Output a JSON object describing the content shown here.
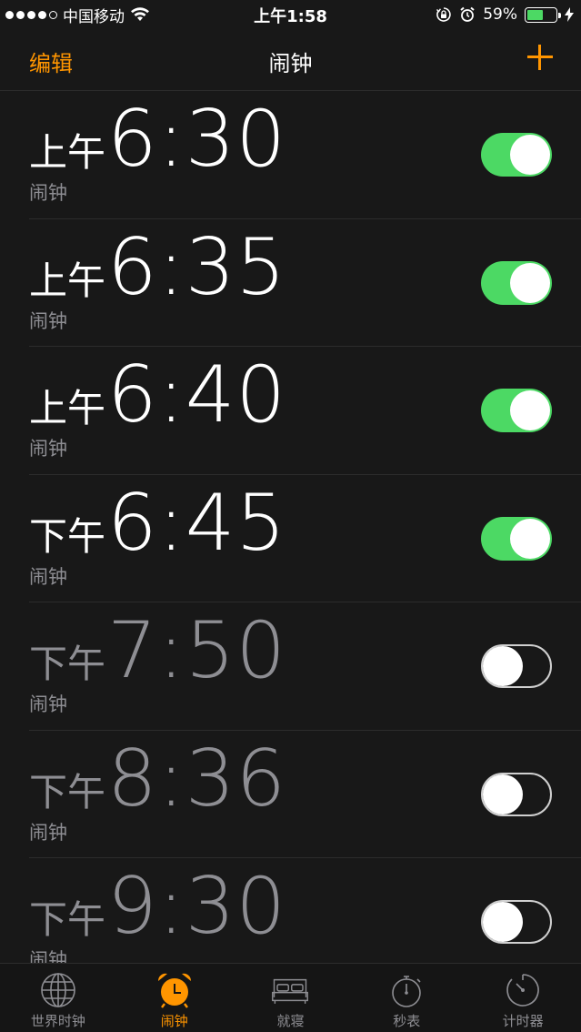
{
  "status_bar": {
    "carrier": "中国移动",
    "time": "上午1:58",
    "battery_percent": "59%",
    "battery_level": 0.59,
    "signal_bars": 4,
    "signal_total": 5
  },
  "nav": {
    "edit_label": "编辑",
    "title": "闹钟"
  },
  "colors": {
    "accent": "#ff9500",
    "toggle_on": "#4cd964",
    "background": "#181818"
  },
  "alarms": [
    {
      "ampm": "上午",
      "time": "6:30",
      "label": "闹钟",
      "enabled": true
    },
    {
      "ampm": "上午",
      "time": "6:35",
      "label": "闹钟",
      "enabled": true
    },
    {
      "ampm": "上午",
      "time": "6:40",
      "label": "闹钟",
      "enabled": true
    },
    {
      "ampm": "下午",
      "time": "6:45",
      "label": "闹钟",
      "enabled": true
    },
    {
      "ampm": "下午",
      "time": "7:50",
      "label": "闹钟",
      "enabled": false
    },
    {
      "ampm": "下午",
      "time": "8:36",
      "label": "闹钟",
      "enabled": false
    },
    {
      "ampm": "下午",
      "time": "9:30",
      "label": "闹钟",
      "enabled": false
    }
  ],
  "tabs": [
    {
      "label": "世界时钟",
      "icon": "globe-icon",
      "active": false
    },
    {
      "label": "闹钟",
      "icon": "alarm-clock-icon",
      "active": true
    },
    {
      "label": "就寝",
      "icon": "bed-icon",
      "active": false
    },
    {
      "label": "秒表",
      "icon": "stopwatch-icon",
      "active": false
    },
    {
      "label": "计时器",
      "icon": "timer-icon",
      "active": false
    }
  ]
}
